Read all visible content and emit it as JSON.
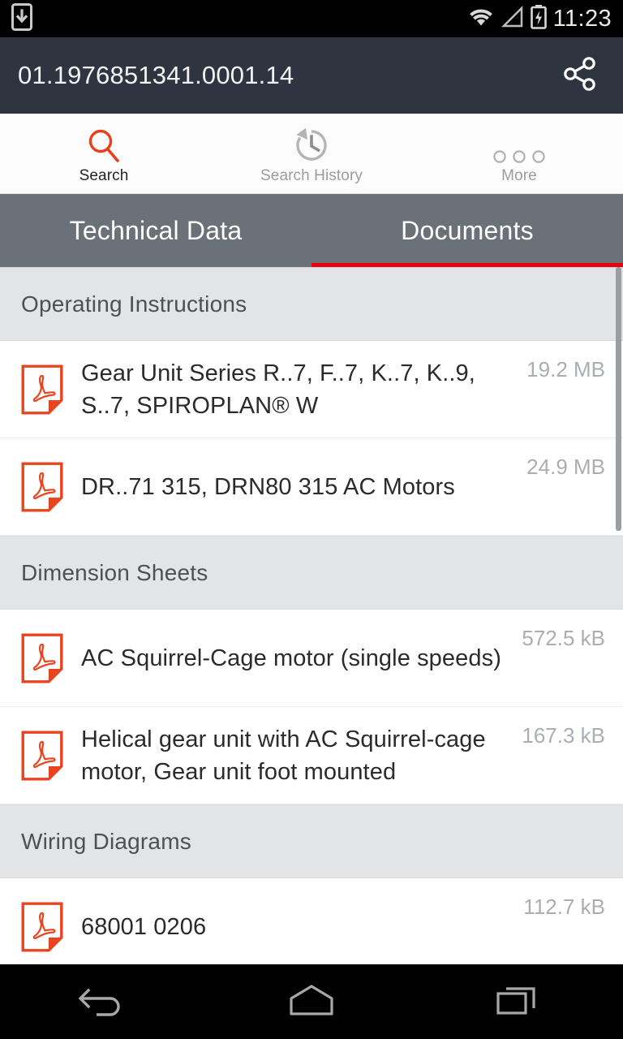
{
  "statusbar": {
    "download_icon": "download-indicator-icon",
    "wifi_icon": "wifi-icon",
    "signal_icon": "cellular-signal-icon",
    "battery_icon": "battery-charging-icon",
    "clock": "11:23"
  },
  "appbar": {
    "title": "01.1976851341.0001.14",
    "share_icon": "share-icon",
    "bg_color": "#2f3540"
  },
  "toolbar": {
    "items": [
      {
        "label": "Search",
        "icon": "search-icon",
        "active": true
      },
      {
        "label": "Search History",
        "icon": "history-icon",
        "active": false
      },
      {
        "label": "More",
        "icon": "more-dots-icon",
        "active": false
      }
    ]
  },
  "tabs": {
    "accent_color": "#e8000d",
    "bar_color": "#6b7179",
    "items": [
      {
        "label": "Technical Data",
        "active": false
      },
      {
        "label": "Documents",
        "active": true
      }
    ]
  },
  "documents": {
    "sections": [
      {
        "title": "Operating Instructions",
        "items": [
          {
            "name": "Gear Unit Series R..7, F..7, K..7, K..9, S..7, SPIROPLAN® W",
            "size": "19.2 MB",
            "icon": "pdf-icon"
          },
          {
            "name": "DR..71  315, DRN80  315 AC Motors",
            "size": "24.9 MB",
            "icon": "pdf-icon"
          }
        ]
      },
      {
        "title": "Dimension Sheets",
        "items": [
          {
            "name": "AC Squirrel-Cage motor (single speeds)",
            "size": "572.5 kB",
            "icon": "pdf-icon"
          },
          {
            "name": "Helical gear unit with AC Squirrel-cage motor, Gear unit foot mounted",
            "size": "167.3 kB",
            "icon": "pdf-icon"
          }
        ]
      },
      {
        "title": "Wiring Diagrams",
        "items": [
          {
            "name": "68001 0206",
            "size": "112.7 kB",
            "icon": "pdf-icon"
          }
        ]
      }
    ]
  },
  "navbar": {
    "back_icon": "back-icon",
    "home_icon": "home-icon",
    "recents_icon": "recent-apps-icon"
  }
}
